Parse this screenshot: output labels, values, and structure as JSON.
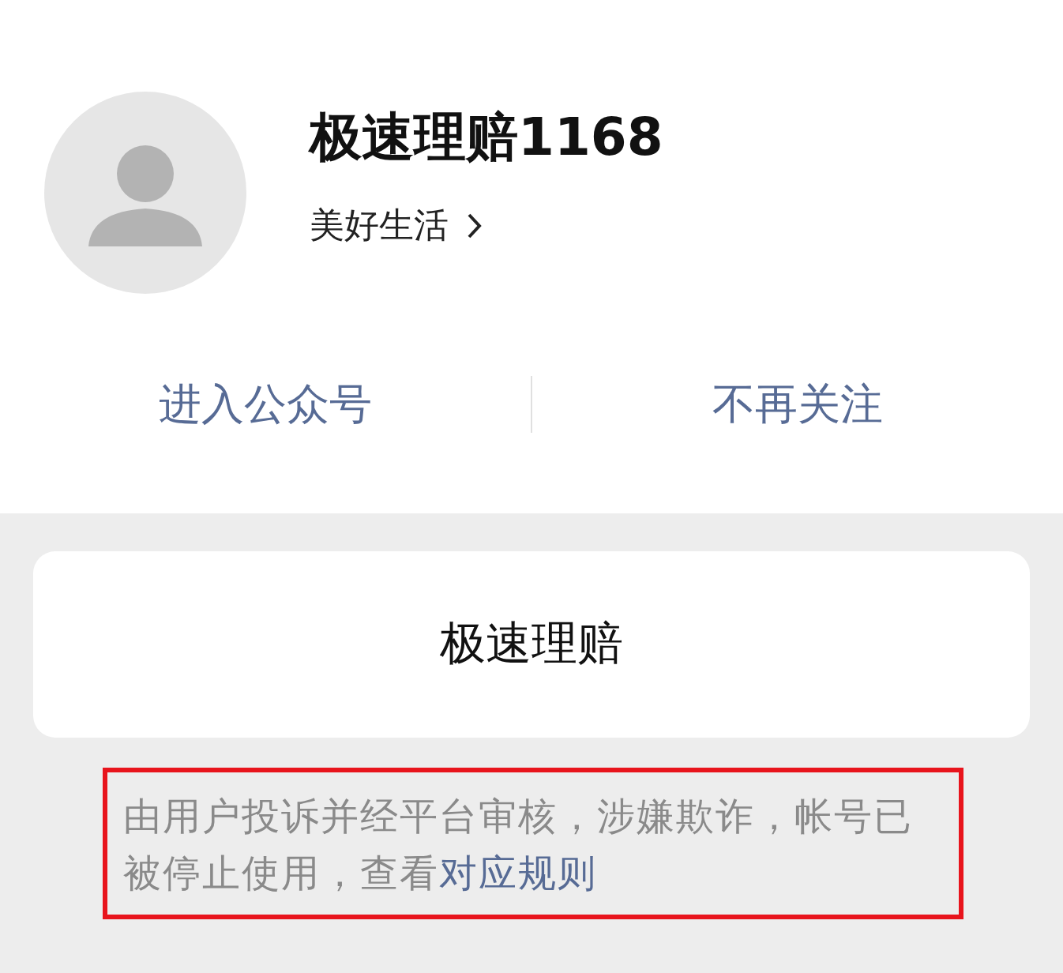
{
  "profile": {
    "name": "极速理赔1168",
    "category": "美好生活"
  },
  "actions": [
    {
      "label": "进入公众号"
    },
    {
      "label": "不再关注"
    }
  ],
  "card": {
    "title": "极速理赔"
  },
  "notice": {
    "text": "由用户投诉并经平台审核，涉嫌欺诈，帐号已被停止使用，查看",
    "link": "对应规则",
    "highlighted": true
  }
}
